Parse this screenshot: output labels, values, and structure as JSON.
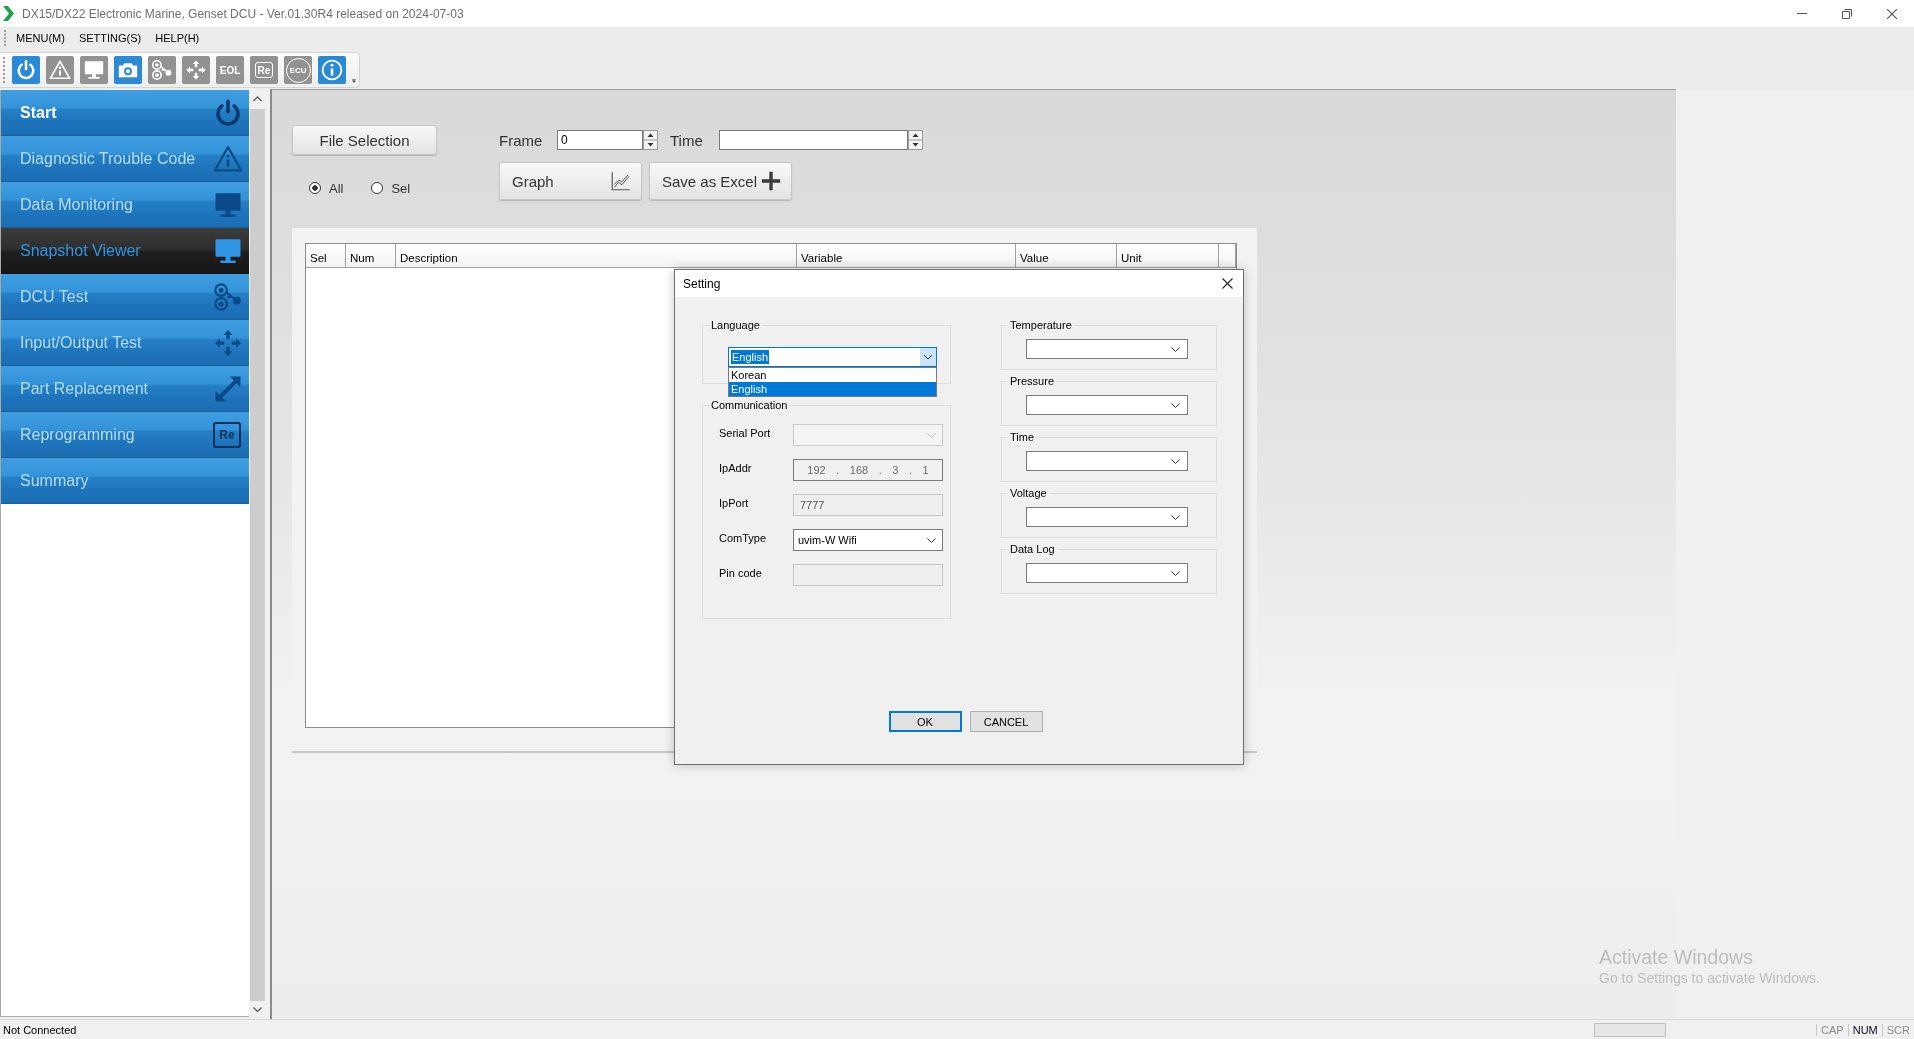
{
  "window": {
    "title": "DX15/DX22 Electronic Marine, Genset DCU - Ver.01.30R4 released on 2024-07-03"
  },
  "menu": [
    {
      "label": "MENU(M)"
    },
    {
      "label": "SETTING(S)"
    },
    {
      "label": "HELP(H)"
    }
  ],
  "toolbar": [
    {
      "kind": "power",
      "disabled": false
    },
    {
      "kind": "warning",
      "disabled": true
    },
    {
      "kind": "monitor",
      "disabled": true
    },
    {
      "kind": "camera",
      "disabled": false
    },
    {
      "kind": "circles",
      "disabled": true
    },
    {
      "kind": "arrows",
      "disabled": true
    },
    {
      "kind": "text",
      "label": "EOL",
      "disabled": true
    },
    {
      "kind": "box-text",
      "label": "Re",
      "disabled": true
    },
    {
      "kind": "circle-text",
      "label": "ECU",
      "disabled": true
    },
    {
      "kind": "info",
      "disabled": false
    }
  ],
  "sidebar": {
    "items": [
      {
        "label": "Start",
        "kind": "power",
        "selected": false,
        "disabled": false
      },
      {
        "label": "Diagnostic Trouble Code",
        "kind": "warning",
        "selected": false,
        "disabled": true
      },
      {
        "label": "Data Monitoring",
        "kind": "monitor",
        "selected": false,
        "disabled": true
      },
      {
        "label": "Snapshot Viewer",
        "kind": "monitor",
        "selected": true,
        "disabled": false
      },
      {
        "label": "DCU Test",
        "kind": "circles",
        "selected": false,
        "disabled": true
      },
      {
        "label": "Input/Output Test",
        "kind": "arrows",
        "selected": false,
        "disabled": true
      },
      {
        "label": "Part Replacement",
        "kind": "diagonal-arrows",
        "selected": false,
        "disabled": true
      },
      {
        "label": "Reprogramming",
        "kind": "box-text",
        "icon_label": "Re",
        "selected": false,
        "disabled": true
      },
      {
        "label": "Summary",
        "kind": "plain",
        "selected": false,
        "disabled": true
      }
    ]
  },
  "snapshot": {
    "file_button": "File Selection",
    "scope": [
      {
        "label": "All",
        "selected": true
      },
      {
        "label": "Sel",
        "selected": false
      }
    ],
    "frame": {
      "label": "Frame",
      "value": "0"
    },
    "time": {
      "label": "Time"
    },
    "actions": [
      {
        "label": "Graph",
        "kind": "chart"
      },
      {
        "label": "Save as Excel",
        "kind": "plus"
      }
    ],
    "table": {
      "columns": [
        "Sel",
        "Num",
        "Description",
        "Variable",
        "Value",
        "Unit"
      ]
    }
  },
  "dialog": {
    "title": "Setting",
    "language": {
      "label": "Language",
      "value": "English",
      "expanded": true,
      "options": [
        {
          "label": "Korean",
          "selected": false
        },
        {
          "label": "English",
          "selected": true
        }
      ]
    },
    "communication": {
      "label": "Communication",
      "fields": [
        {
          "kind": "combo",
          "label": "Serial Port",
          "disabled": true
        },
        {
          "kind": "ip",
          "label": "IpAddr",
          "value_parts": [
            "192",
            ".",
            "168",
            ".",
            "3",
            ".",
            "1"
          ],
          "disabled": true
        },
        {
          "kind": "text",
          "label": "IpPort",
          "value": "7777",
          "disabled": true
        },
        {
          "kind": "combo",
          "label": "ComType",
          "value": "uvim-W Wifi",
          "disabled": false
        },
        {
          "kind": "text",
          "label": "Pin code",
          "disabled": true
        }
      ]
    },
    "unit_groups": [
      {
        "label": "Temperature"
      },
      {
        "label": "Pressure"
      },
      {
        "label": "Time"
      },
      {
        "label": "Voltage"
      },
      {
        "label": "Data Log"
      }
    ],
    "buttons": [
      {
        "label": "OK",
        "focused": true
      },
      {
        "label": "CANCEL",
        "focused": false
      }
    ]
  },
  "status_bar": {
    "text": "Not Connected",
    "indicators": [
      {
        "label": "CAP",
        "on": false
      },
      {
        "label": "NUM",
        "on": true
      },
      {
        "label": "SCR",
        "on": false
      }
    ]
  },
  "activation_notice": {
    "title": "Activate Windows",
    "text": "Go to Settings to activate Windows."
  }
}
